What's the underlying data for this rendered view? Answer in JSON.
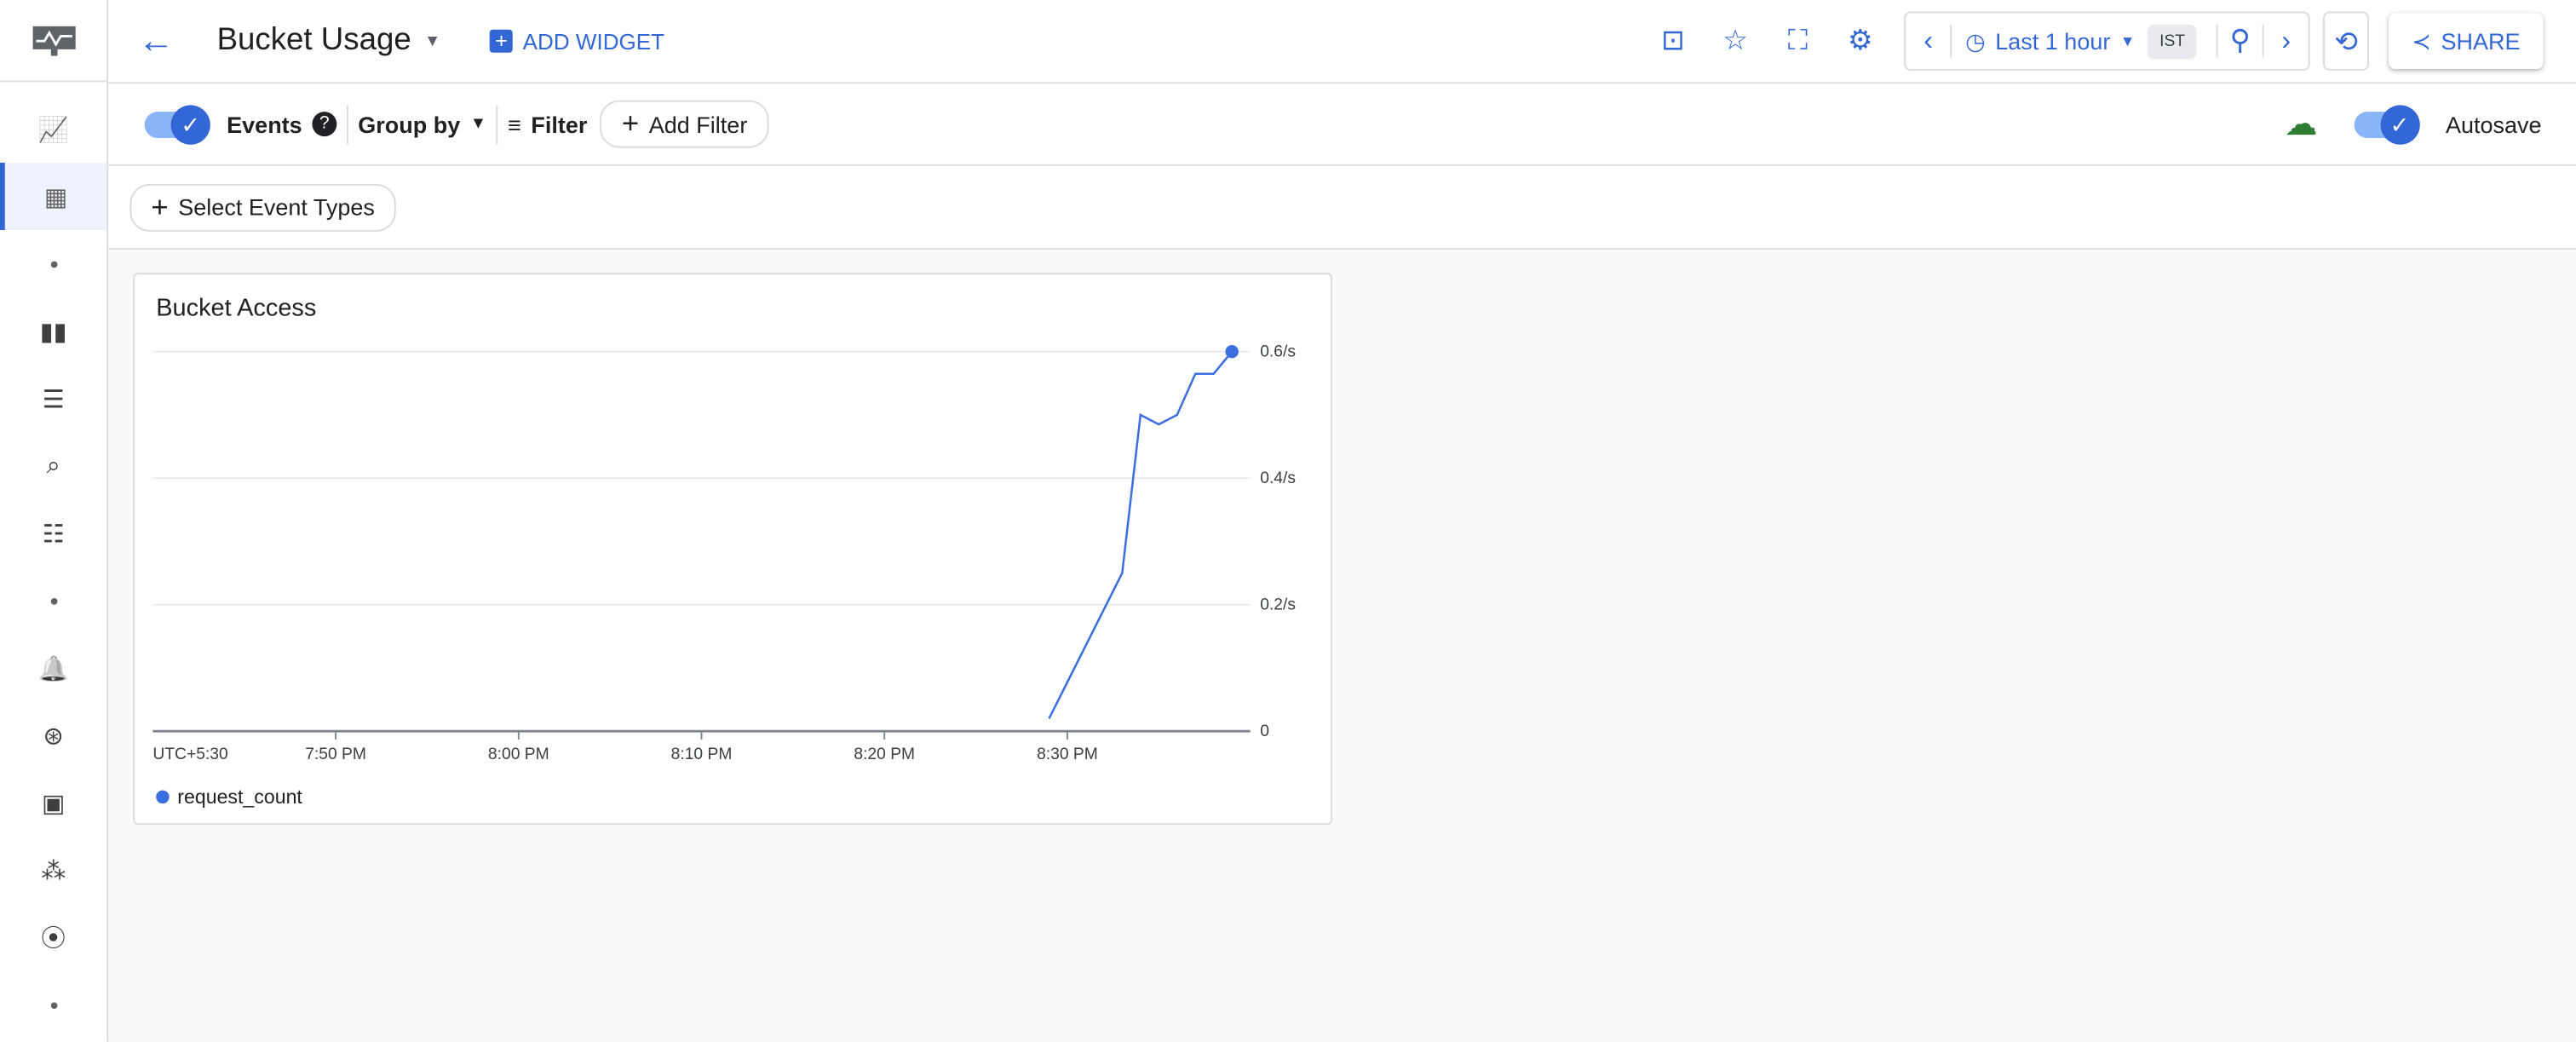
{
  "header": {
    "title": "Bucket Usage",
    "add_widget": "ADD WIDGET",
    "time_range": "Last 1 hour",
    "timezone": "IST",
    "share": "SHARE"
  },
  "toolbar": {
    "events": "Events",
    "group_by": "Group by",
    "filter": "Filter",
    "add_filter": "Add Filter",
    "autosave": "Autosave",
    "select_event_types": "Select Event Types"
  },
  "sidebar": {
    "icons": [
      "monitoring-logo-icon",
      "metrics-explorer-icon",
      "dashboards-icon",
      "dot",
      "bar-chart-icon",
      "logs-icon",
      "log-search-icon",
      "trace-icon",
      "dot",
      "alerting-bell-icon",
      "uptime-icon",
      "monitor-icon",
      "services-icon",
      "groups-icon",
      "dot"
    ],
    "active": 2
  },
  "colors": {
    "accent": "#3367d6",
    "series": "#3b6fe0",
    "saved": "#2e7d32"
  },
  "chart_data": {
    "type": "line",
    "title": "Bucket Access",
    "xlabel": "",
    "ylabel": "",
    "x_ticks": [
      "UTC+5:30",
      "7:50 PM",
      "8:00 PM",
      "8:10 PM",
      "8:20 PM",
      "8:30 PM"
    ],
    "y_ticks": [
      "0",
      "0.2/s",
      "0.4/s",
      "0.6/s"
    ],
    "xlim": [
      "19:40",
      "20:40"
    ],
    "ylim": [
      0,
      0.6
    ],
    "grid": true,
    "legend": "bottom-left",
    "series": [
      {
        "name": "request_count",
        "x": [
          "20:29",
          "20:33",
          "20:34",
          "20:35",
          "20:36",
          "20:37",
          "20:38",
          "20:39"
        ],
        "values": [
          0.02,
          0.25,
          0.5,
          0.485,
          0.5,
          0.565,
          0.565,
          0.6
        ]
      }
    ]
  }
}
